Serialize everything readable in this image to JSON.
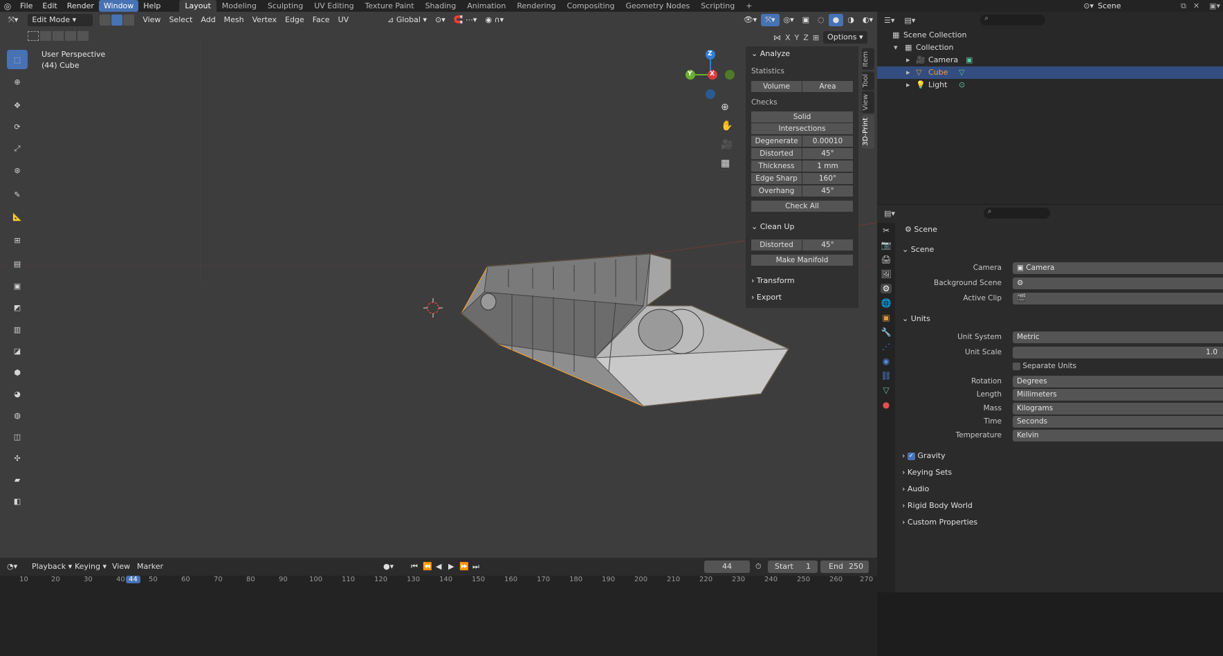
{
  "menus": [
    "File",
    "Edit",
    "Render",
    "Window",
    "Help"
  ],
  "workspaces": [
    "Layout",
    "Modeling",
    "Sculpting",
    "UV Editing",
    "Texture Paint",
    "Shading",
    "Animation",
    "Rendering",
    "Compositing",
    "Geometry Nodes",
    "Scripting"
  ],
  "scene_name": "Scene",
  "header": {
    "mode": "Edit Mode",
    "menu": [
      "View",
      "Select",
      "Add",
      "Mesh",
      "Vertex",
      "Edge",
      "Face",
      "UV"
    ],
    "orientation": "Global",
    "xyz": [
      "X",
      "Y",
      "Z"
    ],
    "options": "Options"
  },
  "viewport": {
    "persp": "User Perspective",
    "object": "(44) Cube",
    "axes": {
      "x": "X",
      "y": "Y",
      "z": "Z"
    }
  },
  "npanel": {
    "tabs": [
      "Item",
      "Tool",
      "View",
      "3D-Print"
    ],
    "analyze": "Analyze",
    "statistics": "Statistics",
    "volume": "Volume",
    "area": "Area",
    "checks": "Checks",
    "solid": "Solid",
    "intersections": "Intersections",
    "rows": [
      {
        "label": "Degenerate",
        "value": "0.00010"
      },
      {
        "label": "Distorted",
        "value": "45°"
      },
      {
        "label": "Thickness",
        "value": "1 mm"
      },
      {
        "label": "Edge Sharp",
        "value": "160°"
      },
      {
        "label": "Overhang",
        "value": "45°"
      }
    ],
    "check_all": "Check All",
    "cleanup": "Clean Up",
    "cleanup_distorted": "Distorted",
    "cleanup_value": "45°",
    "make_manifold": "Make Manifold",
    "transform": "Transform",
    "export": "Export"
  },
  "outliner": {
    "root": "Scene Collection",
    "collection": "Collection",
    "items": [
      "Camera",
      "Cube",
      "Light"
    ]
  },
  "properties": {
    "title": "Scene",
    "scene_section": "Scene",
    "camera_label": "Camera",
    "camera_value": "Camera",
    "bg_label": "Background Scene",
    "clip_label": "Active Clip",
    "units": "Units",
    "unit_system_label": "Unit System",
    "unit_system": "Metric",
    "unit_scale_label": "Unit Scale",
    "unit_scale": "1.0",
    "separate_units": "Separate Units",
    "rotation_label": "Rotation",
    "rotation": "Degrees",
    "length_label": "Length",
    "length": "Millimeters",
    "mass_label": "Mass",
    "mass": "Kilograms",
    "time_label": "Time",
    "time": "Seconds",
    "temperature_label": "Temperature",
    "temperature": "Kelvin",
    "gravity": "Gravity",
    "keying_sets": "Keying Sets",
    "audio": "Audio",
    "rigid_body": "Rigid Body World",
    "custom_props": "Custom Properties"
  },
  "timeline": {
    "playback": "Playback",
    "keying": "Keying",
    "view": "View",
    "marker": "Marker",
    "frame": "44",
    "start_label": "Start",
    "start": "1",
    "end_label": "End",
    "end": "250",
    "ruler": [
      "10",
      "20",
      "30",
      "40",
      "44",
      "50",
      "60",
      "70",
      "80",
      "90",
      "100",
      "110",
      "120",
      "130",
      "140",
      "150",
      "160",
      "170",
      "180",
      "190",
      "200",
      "210",
      "220",
      "230",
      "240",
      "250",
      "260",
      "270"
    ]
  },
  "colors": {
    "accent": "#4772b3",
    "selection": "#f0a030"
  }
}
